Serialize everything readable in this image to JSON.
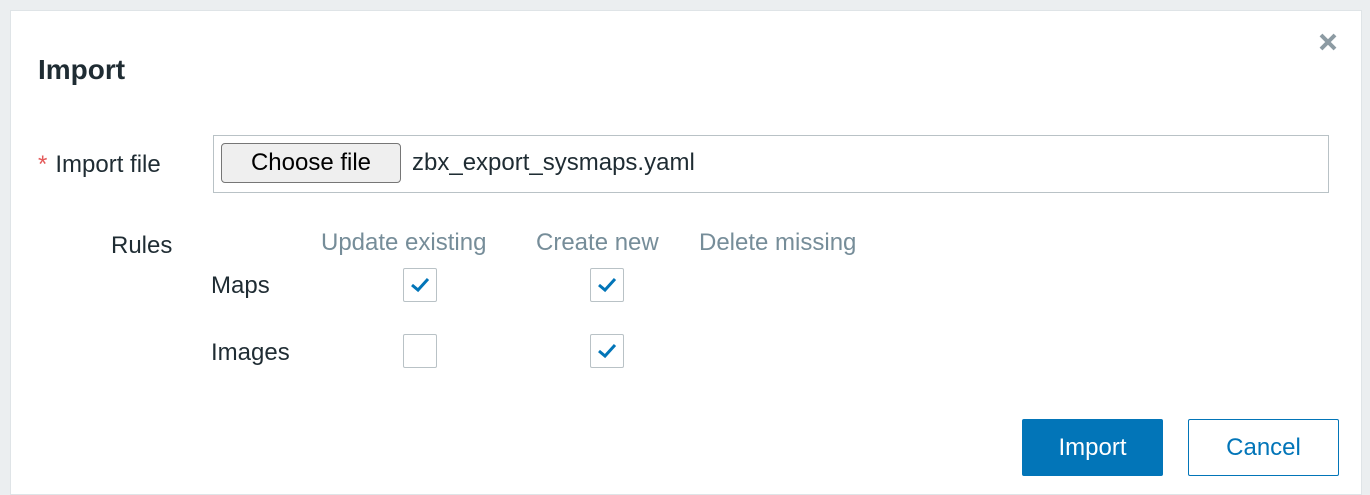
{
  "dialog": {
    "title": "Import",
    "close_icon": "close-icon"
  },
  "import_file": {
    "label": "Import file",
    "required_marker": "*",
    "choose_button_label": "Choose file",
    "file_name": "zbx_export_sysmaps.yaml"
  },
  "rules": {
    "label": "Rules",
    "columns": [
      "Update existing",
      "Create new",
      "Delete missing"
    ],
    "rows": [
      {
        "label": "Maps",
        "update_existing": true,
        "create_new": true
      },
      {
        "label": "Images",
        "update_existing": false,
        "create_new": true
      }
    ]
  },
  "footer": {
    "import_label": "Import",
    "cancel_label": "Cancel"
  },
  "colors": {
    "accent": "#0275b8",
    "required": "#e45959",
    "column_header": "#768d99",
    "text": "#1f2c33"
  }
}
